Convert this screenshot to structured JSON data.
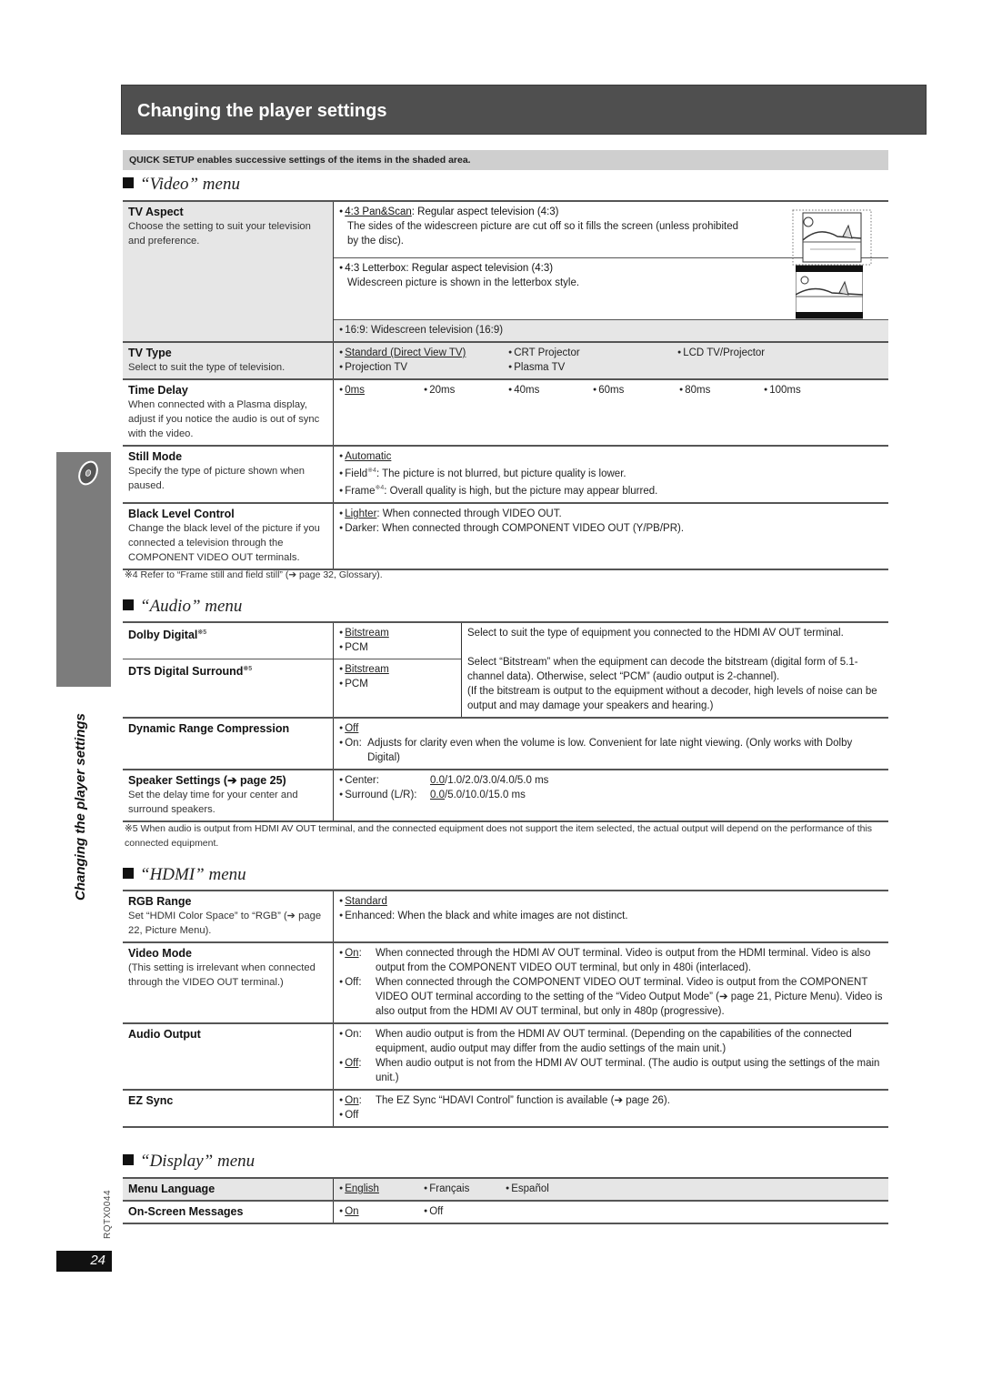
{
  "page": {
    "title": "Changing the player settings",
    "quick_setup_note": "QUICK SETUP enables successive settings of the items in the shaded area.",
    "side_tab_label": "Changing the player settings",
    "model_code": "RQTX0044",
    "page_number": "24"
  },
  "video_menu": {
    "heading": "“Video” menu",
    "tv_aspect": {
      "label": "TV Aspect",
      "desc": "Choose the setting to suit your television and preference.",
      "opt1_name": "4:3 Pan&Scan",
      "opt1_text": ":  Regular aspect television (4:3)",
      "opt1_detail": "The sides of the widescreen picture are cut off so it fills the screen (unless prohibited by the disc).",
      "opt2_name": "4:3 Letterbox",
      "opt2_text": ":  Regular aspect television (4:3)",
      "opt2_detail": "Widescreen picture is shown in the letterbox style.",
      "opt3": "16:9:  Widescreen television (16:9)"
    },
    "tv_type": {
      "label": "TV Type",
      "desc": "Select to suit the type of television.",
      "options": [
        "Standard (Direct View TV)",
        "CRT Projector",
        "LCD TV/Projector",
        "Projection TV",
        "Plasma TV"
      ]
    },
    "time_delay": {
      "label": "Time Delay",
      "desc": "When connected with a Plasma display, adjust if you notice the audio is out of sync with the video.",
      "options": [
        "0ms",
        "20ms",
        "40ms",
        "60ms",
        "80ms",
        "100ms"
      ]
    },
    "still_mode": {
      "label": "Still Mode",
      "desc": "Specify the type of picture shown when paused.",
      "opt1": "Automatic",
      "opt2_name": "Field",
      "opt2_mark": "※4",
      "opt2_text": ":   The picture is not blurred, but picture quality is lower.",
      "opt3_name": "Frame",
      "opt3_mark": "※4",
      "opt3_text": ": Overall quality is high, but the picture may appear blurred."
    },
    "black_level": {
      "label": "Black Level Control",
      "desc": "Change the black level of the picture if you connected a television through the COMPONENT VIDEO OUT terminals.",
      "opt1_name": "Lighter",
      "opt1_text": ":  When connected through VIDEO OUT.",
      "opt2_name": "Darker",
      "opt2_text": ":  When connected through COMPONENT VIDEO OUT (Y/PB/PR)."
    },
    "footnote": "※4 Refer to “Frame still and field still” (➔ page 32, Glossary)."
  },
  "audio_menu": {
    "heading": "“Audio” menu",
    "dolby": {
      "label": "Dolby Digital",
      "mark": "※5",
      "opt1": "Bitstream",
      "opt2": "PCM"
    },
    "dts": {
      "label": "DTS Digital Surround",
      "mark": "※5",
      "opt1": "Bitstream",
      "opt2": "PCM"
    },
    "shared_note_1": "Select to suit the type of equipment you connected to the HDMI AV OUT terminal.",
    "shared_note_2": "Select “Bitstream” when the equipment can decode the bitstream (digital form of 5.1-channel data). Otherwise, select “PCM” (audio output is 2-channel).",
    "shared_note_3": "(If the bitstream is output to the equipment without a decoder, high levels of noise can be output and may damage your speakers and hearing.)",
    "drc": {
      "label": "Dynamic Range Compression",
      "opt1": "Off",
      "opt2_name": "On",
      "opt2_text": "Adjusts for clarity even when the volume is low. Convenient for late night viewing. (Only works with Dolby Digital)"
    },
    "speaker": {
      "label": "Speaker Settings (➔ page 25)",
      "desc": "Set the delay time for your center and surround speakers.",
      "center_label": "Center:",
      "center_default": "0.0",
      "center_rest": "/1.0/2.0/3.0/4.0/5.0 ms",
      "surround_label": "Surround (L/R):",
      "surround_default": "0.0",
      "surround_rest": "/5.0/10.0/15.0 ms"
    },
    "footnote": "※5 When audio is output from HDMI AV OUT terminal, and the connected equipment does not support the item selected, the actual output will depend on the performance of this connected equipment."
  },
  "hdmi_menu": {
    "heading": "“HDMI” menu",
    "rgb": {
      "label": "RGB Range",
      "desc": "Set “HDMI Color Space” to “RGB” (➔ page 22, Picture Menu).",
      "opt1": "Standard",
      "opt2": "Enhanced: When the black and white images are not distinct."
    },
    "video_mode": {
      "label": "Video Mode",
      "desc": "(This setting is irrelevant when connected through the VIDEO OUT terminal.)",
      "opt1_name": "On",
      "opt1_text": "When connected through the HDMI AV OUT terminal. Video is output from the HDMI terminal. Video is also output from the COMPONENT VIDEO OUT terminal, but only in 480i (interlaced).",
      "opt2_name": "Off",
      "opt2_text": "When connected through the COMPONENT VIDEO OUT terminal. Video is output from the COMPONENT VIDEO OUT terminal according to the setting of the “Video Output Mode” (➔ page 21, Picture Menu). Video is also output from the HDMI AV OUT terminal, but only in 480p (progressive)."
    },
    "audio_output": {
      "label": "Audio Output",
      "opt1_name": "On",
      "opt1_text": "When audio output is from the HDMI AV OUT terminal. (Depending on the capabilities of the connected equipment, audio output may differ from the audio settings of the main unit.)",
      "opt2_name": "Off",
      "opt2_text": "When audio output is not from the HDMI AV OUT terminal. (The audio is output using the settings of the main unit.)"
    },
    "ez_sync": {
      "label": "EZ Sync",
      "opt1_name": "On",
      "opt1_text": "The EZ Sync “HDAVI Control” function is available (➔ page 26).",
      "opt2": "Off"
    }
  },
  "display_menu": {
    "heading": "“Display” menu",
    "menu_language": {
      "label": "Menu Language",
      "options": [
        "English",
        "Français",
        "Español"
      ]
    },
    "osm": {
      "label": "On-Screen Messages",
      "options": [
        "On",
        "Off"
      ]
    }
  }
}
